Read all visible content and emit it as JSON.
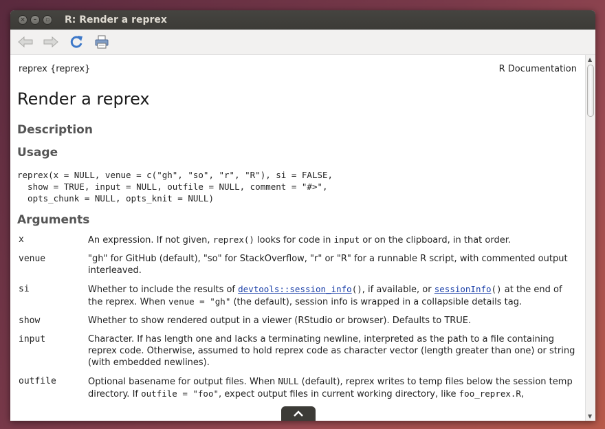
{
  "window": {
    "title": "R: Render a reprex"
  },
  "toolbar": {
    "back_icon": "back-arrow-icon",
    "forward_icon": "forward-arrow-icon",
    "reload_icon": "reload-icon",
    "print_icon": "print-icon"
  },
  "doc": {
    "package_label": "reprex {reprex}",
    "doc_label": "R Documentation",
    "title": "Render a reprex",
    "description_heading": "Description",
    "usage_heading": "Usage",
    "usage_code": "reprex(x = NULL, venue = c(\"gh\", \"so\", \"r\", \"R\"), si = FALSE,\n  show = TRUE, input = NULL, outfile = NULL, comment = \"#>\",\n  opts_chunk = NULL, opts_knit = NULL)",
    "arguments_heading": "Arguments",
    "args": {
      "x": {
        "name": "x",
        "d1": "An expression. If not given, ",
        "c1": "reprex()",
        "d2": " looks for code in ",
        "c2": "input",
        "d3": " or on the clipboard, in that order."
      },
      "venue": {
        "name": "venue",
        "d1": "\"gh\" for GitHub (default), \"so\" for StackOverflow, \"r\" or \"R\" for a runnable R script, with commented output interleaved."
      },
      "si": {
        "name": "si",
        "d1": "Whether to include the results of ",
        "link1": "devtools::session_info",
        "c1": "()",
        "d2": ", if available, or ",
        "link2": "sessionInfo",
        "c2": "()",
        "d3": " at the end of the reprex. When ",
        "c3": "venue = \"gh\"",
        "d4": " (the default), session info is wrapped in a collapsible details tag."
      },
      "show": {
        "name": "show",
        "d1": "Whether to show rendered output in a viewer (RStudio or browser). Defaults to TRUE."
      },
      "input": {
        "name": "input",
        "d1": "Character. If has length one and lacks a terminating newline, interpreted as the path to a file containing reprex code. Otherwise, assumed to hold reprex code as character vector (length greater than one) or string (with embedded newlines)."
      },
      "outfile": {
        "name": "outfile",
        "d1": "Optional basename for output files. When ",
        "c1": "NULL",
        "d2": " (default), reprex writes to temp files below the session temp directory. If ",
        "c2": "outfile = \"foo\"",
        "d3": ", expect output files in current working directory, like ",
        "c3": "foo_reprex.R",
        "d4": ","
      }
    }
  },
  "scroll_top_icon": "chevron-up-icon"
}
